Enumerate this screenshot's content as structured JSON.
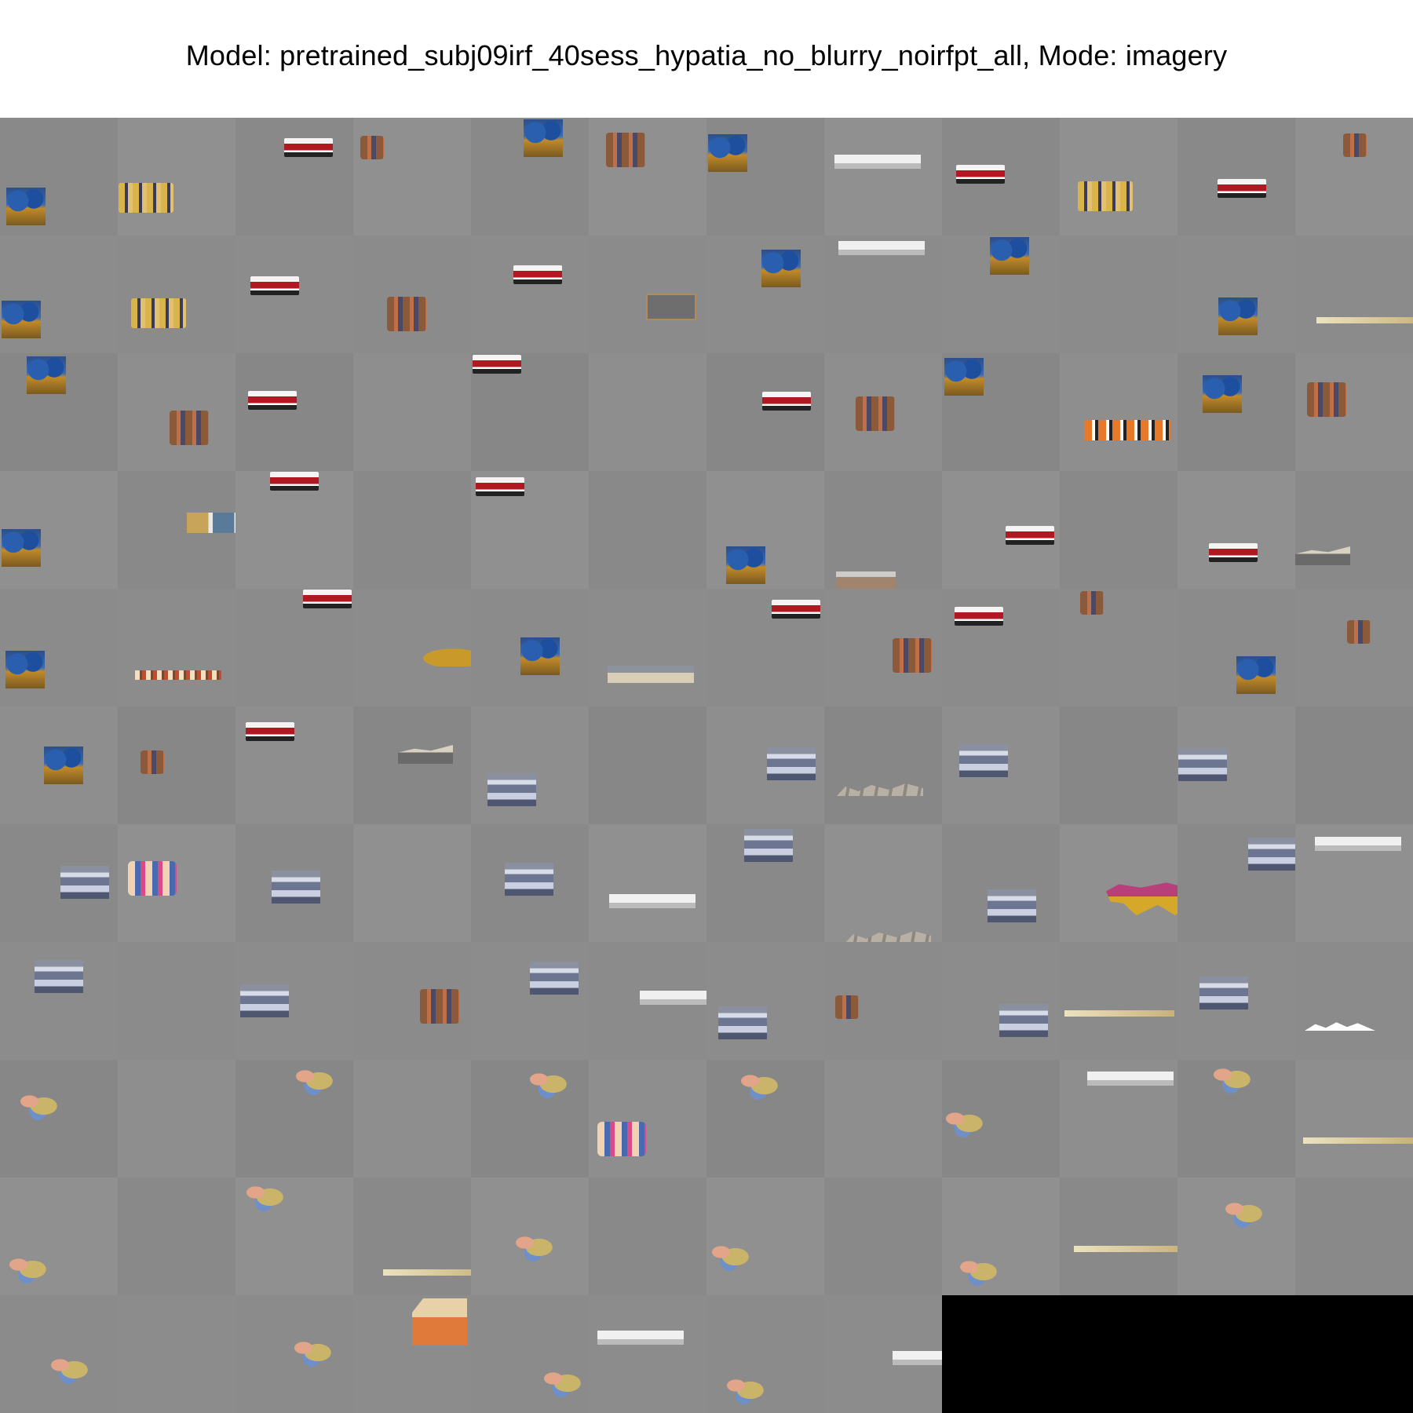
{
  "figure": {
    "title": "Model: pretrained_subj09irf_40sess_hypatia_no_blurry_noirfpt_all, Mode: imagery",
    "colors": {
      "cell_bg": "#8a8a8a",
      "cell_bg_alt": "#8f8f8f",
      "empty_bg": "#000000"
    }
  },
  "grid": {
    "rows": 11,
    "cols": 12,
    "cells": [
      [
        "flowers",
        "crowd",
        "truck",
        "figure",
        "flowers",
        "soldiers",
        "flowers",
        "text-ar",
        "truck",
        "crowd",
        "truck",
        "face"
      ],
      [
        "flowers",
        "crowd",
        "truck",
        "people",
        "truck",
        "board",
        "flowers",
        "room",
        "flowers",
        "blank",
        "flowers",
        "strip"
      ],
      [
        "flowers",
        "people",
        "truck",
        "blank",
        "truck",
        "blank",
        "truck",
        "people",
        "flowers",
        "orange",
        "flowers",
        "people"
      ],
      [
        "flowers",
        "photos",
        "truck",
        "blank",
        "truck",
        "blank",
        "flowers",
        "wall",
        "truck",
        "blank",
        "truck",
        "rock"
      ],
      [
        "flowers",
        "family",
        "truck",
        "bush",
        "flowers",
        "building",
        "truck",
        "people",
        "truck",
        "person",
        "flowers",
        "person"
      ],
      [
        "flowers",
        "person",
        "truck",
        "rock",
        "mountain",
        "blank",
        "mountain",
        "rocks",
        "mountain",
        "blank",
        "mountain",
        "blank"
      ],
      [
        "mountain",
        "kids",
        "mountain",
        "blank",
        "mountain",
        "white",
        "mountain",
        "rocks",
        "mountain",
        "cat",
        "mountain",
        "text"
      ],
      [
        "mountain",
        "blank",
        "mountain",
        "people",
        "mountain",
        "logo",
        "mountain",
        "person",
        "mountain",
        "strip",
        "mountain",
        "hills"
      ],
      [
        "baby",
        "blank",
        "baby",
        "blank",
        "baby",
        "kids",
        "baby",
        "blank",
        "baby",
        "text",
        "baby",
        "strip"
      ],
      [
        "baby",
        "blank",
        "baby",
        "strip",
        "baby",
        "blank",
        "baby",
        "blank",
        "baby",
        "strip",
        "baby",
        "blank"
      ],
      [
        "baby",
        "blank",
        "baby",
        "box",
        "baby",
        "text",
        "baby",
        "text",
        "empty",
        "empty",
        "empty",
        "empty"
      ]
    ]
  }
}
